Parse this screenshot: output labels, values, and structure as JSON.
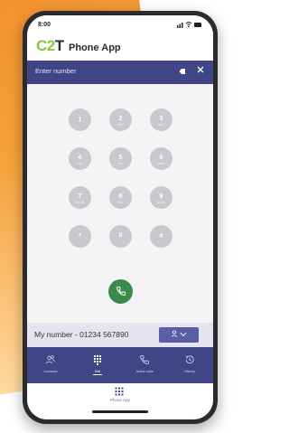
{
  "status_bar": {
    "time": "8:00",
    "indicators": "signal-wifi-battery"
  },
  "header": {
    "logo_c": "C",
    "logo_2": "2",
    "logo_t": "T",
    "title": "Phone App"
  },
  "number_entry": {
    "placeholder": "Enter number",
    "backspace_icon": "backspace-icon",
    "clear_icon": "close-icon"
  },
  "keypad": {
    "keys": [
      {
        "digit": "1",
        "letters": ""
      },
      {
        "digit": "2",
        "letters": "ABC"
      },
      {
        "digit": "3",
        "letters": "DEF"
      },
      {
        "digit": "4",
        "letters": "GHI"
      },
      {
        "digit": "5",
        "letters": "JKL"
      },
      {
        "digit": "6",
        "letters": "MNO"
      },
      {
        "digit": "7",
        "letters": "PQRS"
      },
      {
        "digit": "8",
        "letters": "TUV"
      },
      {
        "digit": "9",
        "letters": "WXYZ"
      },
      {
        "digit": "*",
        "letters": ""
      },
      {
        "digit": "0",
        "letters": "+"
      },
      {
        "digit": "#",
        "letters": ""
      }
    ],
    "call_icon": "phone-icon"
  },
  "my_number": {
    "label": "My number - 01234 567890",
    "dropdown_icon": "person-icon"
  },
  "tabs": [
    {
      "label": "Contacts",
      "icon": "contacts-icon",
      "active": false
    },
    {
      "label": "Dial",
      "icon": "dialpad-icon",
      "active": true
    },
    {
      "label": "Active calls",
      "icon": "phone-icon",
      "active": false
    },
    {
      "label": "History",
      "icon": "history-icon",
      "active": false
    }
  ],
  "bottom_app": {
    "label": "Phone App",
    "icon": "grid-icon"
  },
  "colors": {
    "primary": "#3f4585",
    "call_green": "#3c8a4b",
    "logo_accent": "#8cc63f",
    "key_gray": "#c9c9cd",
    "background_orange": "#f08a2a"
  }
}
